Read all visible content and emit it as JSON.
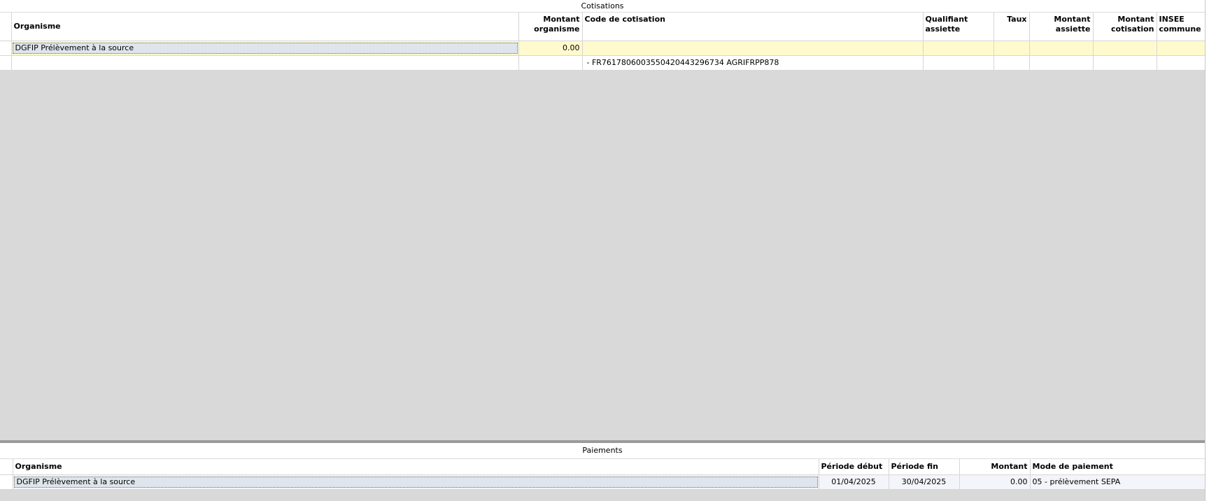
{
  "cotisations": {
    "title": "Cotisations",
    "headers": {
      "organisme": "Organisme",
      "montant_organisme": "Montant organisme",
      "code_cotisation": "Code de cotisation",
      "qualifiant_assiette": "Qualifiant assiette",
      "taux": "Taux",
      "montant_assiette": "Montant assiette",
      "montant_cotisation": "Montant cotisation",
      "insee_commune": "INSEE commune"
    },
    "rows": [
      {
        "organisme": "DGFIP Prélèvement à la source",
        "montant_organisme": "0.00",
        "code_cotisation": "",
        "qualifiant_assiette": "",
        "taux": "",
        "montant_assiette": "",
        "montant_cotisation": "",
        "insee_commune": ""
      },
      {
        "organisme": "",
        "montant_organisme": "",
        "code_cotisation": "- FR7617806003550420443296734 AGRIFRPP878",
        "qualifiant_assiette": "",
        "taux": "",
        "montant_assiette": "",
        "montant_cotisation": "",
        "insee_commune": ""
      }
    ]
  },
  "paiements": {
    "title": "Paiements",
    "headers": {
      "organisme": "Organisme",
      "periode_debut": "Période début",
      "periode_fin": "Période fin",
      "montant": "Montant",
      "mode_paiement": "Mode de paiement"
    },
    "rows": [
      {
        "organisme": "DGFIP Prélèvement à la source",
        "periode_debut": "01/04/2025",
        "periode_fin": "30/04/2025",
        "montant": "0.00",
        "mode_paiement": "05 - prélèvement SEPA"
      }
    ]
  },
  "colors": {
    "selected_row": "#fffacd",
    "focused_cell": "#dee5ec",
    "empty_area": "#d9d9d9",
    "splitter": "#9a9a9a"
  }
}
